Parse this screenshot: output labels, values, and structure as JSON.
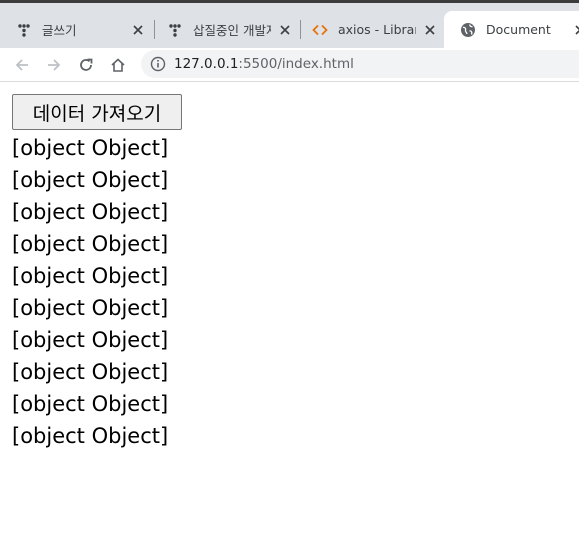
{
  "browser": {
    "tabs": [
      {
        "title": "글쓰기",
        "favicon": "velog-dots-icon",
        "active": false
      },
      {
        "title": "삽질중인 개발자",
        "favicon": "velog-dots-icon",
        "active": false
      },
      {
        "title": "axios - Libraries",
        "favicon": "code-brackets-icon",
        "active": false
      },
      {
        "title": "Document",
        "favicon": "globe-icon",
        "active": true
      }
    ],
    "close_glyph": "×",
    "address": {
      "host": "127.0.0.1",
      "path": ":5500/index.html"
    }
  },
  "page": {
    "fetch_button_label": "데이터 가져오기",
    "results": [
      "[object Object]",
      "[object Object]",
      "[object Object]",
      "[object Object]",
      "[object Object]",
      "[object Object]",
      "[object Object]",
      "[object Object]",
      "[object Object]",
      "[object Object]"
    ]
  },
  "colors": {
    "tabstrip": "#dee1e6",
    "accent_orange": "#e8710a",
    "omnibox": "#f1f3f4"
  }
}
